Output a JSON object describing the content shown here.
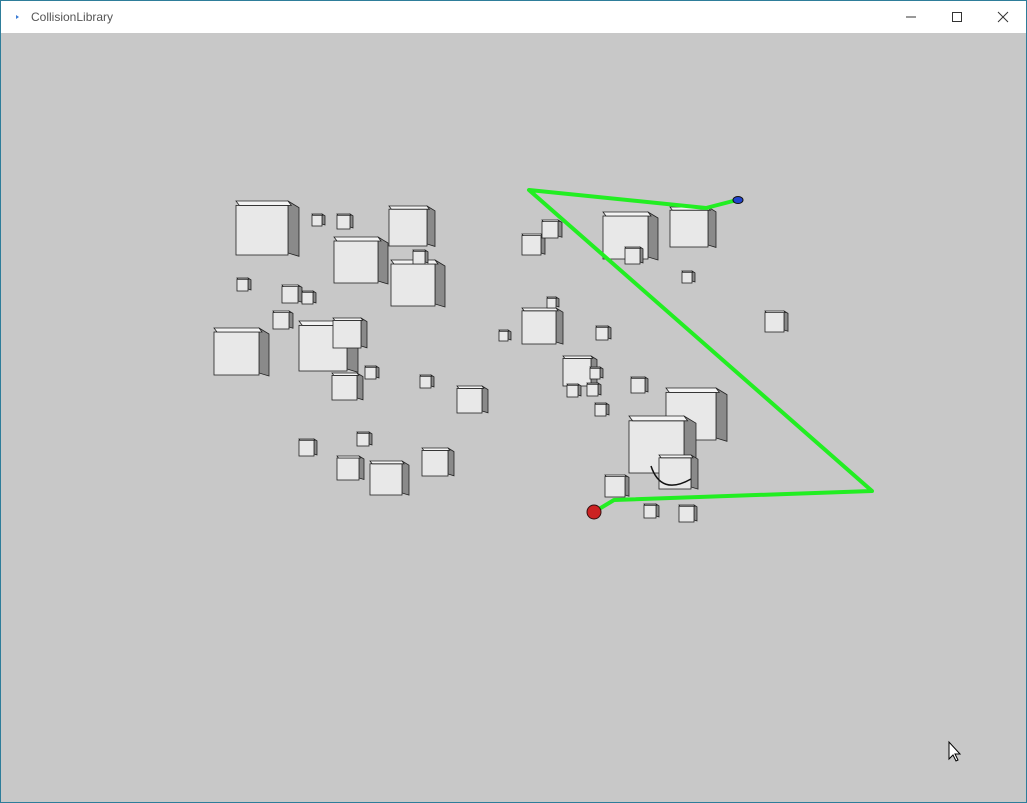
{
  "window": {
    "title": "CollisionLibrary",
    "controls": {
      "minimize": "minimize-icon",
      "maximize": "maximize-icon",
      "close": "close-icon"
    }
  },
  "scene": {
    "background_color": "#c8c8c8",
    "box_color": "#e8e8e8",
    "path_color": "#22ee22",
    "start_marker_color": "#cc2222",
    "goal_marker_color": "#2244cc"
  },
  "cursor": "mouse-pointer-icon"
}
